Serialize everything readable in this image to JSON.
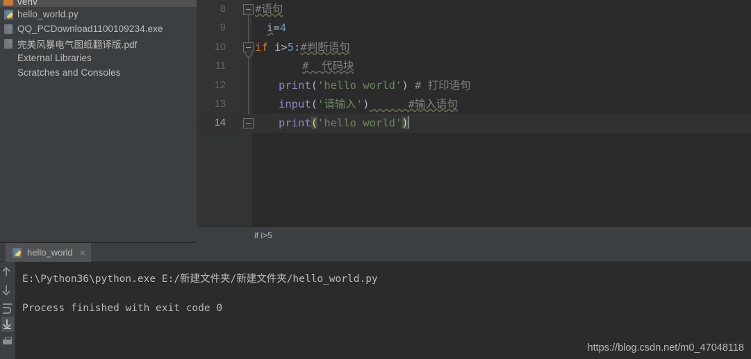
{
  "colors": {
    "editor_bg": "#2b2b2b",
    "panel_bg": "#3c3f41",
    "gutter_bg": "#313335",
    "selection_bg": "#4e5052",
    "current_line_bg": "#323232",
    "keyword": "#cc7832",
    "number": "#6897bb",
    "string": "#6a8759",
    "comment": "#808080",
    "function": "#8888c6",
    "text": "#a9b7c6",
    "bracket_match": "#ffc66d"
  },
  "sidebar": {
    "items": [
      {
        "label": "venv",
        "icon": "folder-icon",
        "selected": true
      },
      {
        "label": "hello_world.py",
        "icon": "python-file-icon",
        "selected": false
      },
      {
        "label": "QQ_PCDownload1100109234.exe",
        "icon": "unknown-file-icon",
        "selected": false
      },
      {
        "label": "完美风暴电气图纸翻译版.pdf",
        "icon": "unknown-file-icon",
        "selected": false
      },
      {
        "label": "External Libraries",
        "icon": "none",
        "selected": false
      },
      {
        "label": "Scratches and Consoles",
        "icon": "none",
        "selected": false
      }
    ]
  },
  "editor": {
    "lines": [
      {
        "number": "8",
        "fold": "collapse-box",
        "indent": 0,
        "tokens": [
          {
            "text": "#语句",
            "type": "comment",
            "squiggle": true
          }
        ]
      },
      {
        "number": "9",
        "fold": "none",
        "indent": 1,
        "tokens": [
          {
            "text": "i",
            "type": "var",
            "squiggle": true
          },
          {
            "text": "=",
            "type": "punct"
          },
          {
            "text": "4",
            "type": "num"
          }
        ]
      },
      {
        "number": "10",
        "fold": "collapse-arrow",
        "indent": 0,
        "tokens": [
          {
            "text": "if",
            "type": "kw"
          },
          {
            "text": " i",
            "type": "var"
          },
          {
            "text": ">",
            "type": "punct"
          },
          {
            "text": "5",
            "type": "num"
          },
          {
            "text": ":",
            "type": "punct"
          },
          {
            "text": "#判断语句",
            "type": "comment",
            "squiggle": true
          }
        ]
      },
      {
        "number": "11",
        "fold": "none",
        "indent": 4,
        "tokens": [
          {
            "text": "#  代码块",
            "type": "comment",
            "squiggle": true
          }
        ]
      },
      {
        "number": "12",
        "fold": "none",
        "indent": 2,
        "tokens": [
          {
            "text": "print",
            "type": "func"
          },
          {
            "text": "(",
            "type": "punct"
          },
          {
            "text": "'hello world'",
            "type": "str"
          },
          {
            "text": ")",
            "type": "punct"
          },
          {
            "text": " # 打印语句",
            "type": "comment"
          }
        ]
      },
      {
        "number": "13",
        "fold": "none",
        "indent": 2,
        "tokens": [
          {
            "text": "input",
            "type": "func"
          },
          {
            "text": "(",
            "type": "punct"
          },
          {
            "text": "'请输入'",
            "type": "str"
          },
          {
            "text": ")",
            "type": "punct"
          },
          {
            "text": "      #输入语句",
            "type": "comment",
            "squiggle": true
          }
        ]
      },
      {
        "number": "14",
        "fold": "collapse-box",
        "indent": 2,
        "current": true,
        "tokens": [
          {
            "text": "print",
            "type": "func"
          },
          {
            "text": "(",
            "type": "brace"
          },
          {
            "text": "'hello world'",
            "type": "str"
          },
          {
            "text": ")",
            "type": "brace"
          },
          {
            "text": "",
            "type": "caret"
          }
        ]
      }
    ]
  },
  "breadcrumb": {
    "path": "if i>5"
  },
  "run_panel": {
    "tab": {
      "label": "hello_world",
      "icon": "python-file-icon",
      "close_label": "×"
    },
    "tools": [
      {
        "name": "rerun-up-icon",
        "icon": "arrow-up-icon",
        "active": false
      },
      {
        "name": "rerun-down-icon",
        "icon": "arrow-down-icon",
        "active": false
      },
      {
        "name": "soft-wrap-icon",
        "icon": "soft-wrap-icon",
        "active": false
      },
      {
        "name": "scroll-to-end-icon",
        "icon": "scroll-end-icon",
        "active": true
      },
      {
        "name": "print-icon",
        "icon": "print-icon",
        "active": false
      }
    ],
    "output": [
      "E:\\Python36\\python.exe E:/新建文件夹/新建文件夹/hello_world.py",
      "Process finished with exit code 0"
    ]
  },
  "watermark": {
    "text": "https://blog.csdn.net/m0_47048118"
  }
}
